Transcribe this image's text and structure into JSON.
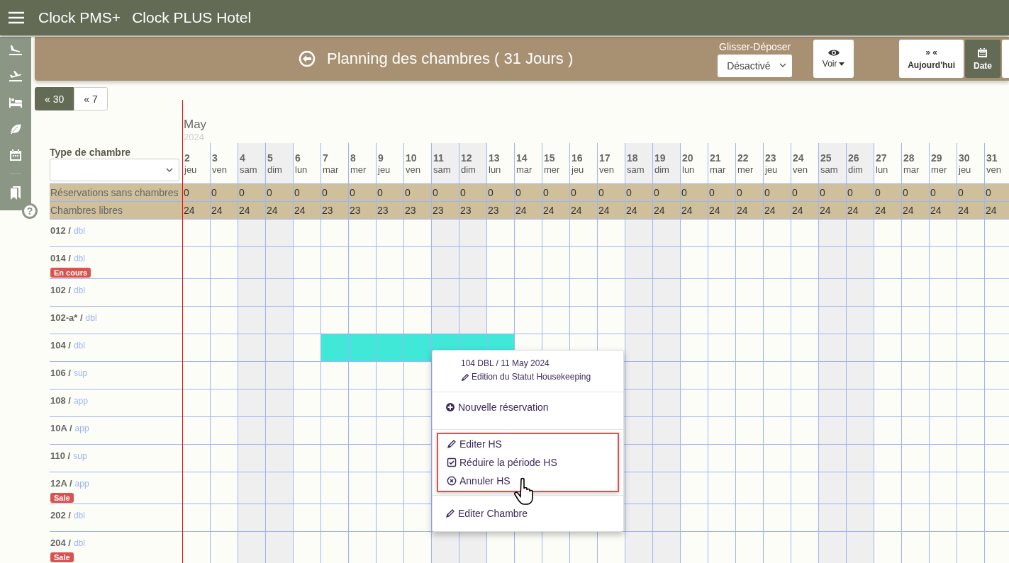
{
  "topbar": {
    "app": "Clock PMS+",
    "hotel": "Clock PLUS Hotel"
  },
  "sidebar": {
    "items": [
      {
        "kind": "arrival"
      },
      {
        "kind": "departure"
      },
      {
        "kind": "bed"
      },
      {
        "kind": "leaf"
      },
      {
        "kind": "calendar"
      },
      {
        "kind": "bookmark"
      }
    ],
    "help": "?"
  },
  "header": {
    "title": "Planning des chambres ( 31 Jours )",
    "drag_label": "Glisser-Déposer",
    "drag_value": "Désactivé",
    "view_button": "Voir",
    "view_buttons": [
      {
        "top": "» «",
        "label": "Aujourd'hui",
        "selected": false
      },
      {
        "kind": "calendar",
        "label": "Date",
        "selected": true
      },
      {
        "selected": false
      }
    ]
  },
  "range_buttons": [
    {
      "label": "« 30",
      "selected": true
    },
    {
      "label": "« 7",
      "selected": false
    }
  ],
  "planning": {
    "month": "May",
    "year": "2024",
    "type_label": "Type de chambre",
    "unassigned_label": "Réservations sans chambres",
    "free_label": "Chambres libres",
    "days": [
      {
        "day": "2",
        "weekday": "jeu",
        "weekend": false,
        "unassigned": "0",
        "free": "24"
      },
      {
        "day": "3",
        "weekday": "ven",
        "weekend": false,
        "unassigned": "0",
        "free": "24"
      },
      {
        "day": "4",
        "weekday": "sam",
        "weekend": true,
        "unassigned": "0",
        "free": "24"
      },
      {
        "day": "5",
        "weekday": "dim",
        "weekend": true,
        "unassigned": "0",
        "free": "24"
      },
      {
        "day": "6",
        "weekday": "lun",
        "weekend": false,
        "unassigned": "0",
        "free": "24"
      },
      {
        "day": "7",
        "weekday": "mar",
        "weekend": false,
        "unassigned": "0",
        "free": "23"
      },
      {
        "day": "8",
        "weekday": "mer",
        "weekend": false,
        "unassigned": "0",
        "free": "23"
      },
      {
        "day": "9",
        "weekday": "jeu",
        "weekend": false,
        "unassigned": "0",
        "free": "23"
      },
      {
        "day": "10",
        "weekday": "ven",
        "weekend": false,
        "unassigned": "0",
        "free": "23"
      },
      {
        "day": "11",
        "weekday": "sam",
        "weekend": true,
        "unassigned": "0",
        "free": "23"
      },
      {
        "day": "12",
        "weekday": "dim",
        "weekend": true,
        "unassigned": "0",
        "free": "23"
      },
      {
        "day": "13",
        "weekday": "lun",
        "weekend": false,
        "unassigned": "0",
        "free": "23"
      },
      {
        "day": "14",
        "weekday": "mar",
        "weekend": false,
        "unassigned": "0",
        "free": "24"
      },
      {
        "day": "15",
        "weekday": "mer",
        "weekend": false,
        "unassigned": "0",
        "free": "24"
      },
      {
        "day": "16",
        "weekday": "jeu",
        "weekend": false,
        "unassigned": "0",
        "free": "24"
      },
      {
        "day": "17",
        "weekday": "ven",
        "weekend": false,
        "unassigned": "0",
        "free": "24"
      },
      {
        "day": "18",
        "weekday": "sam",
        "weekend": true,
        "unassigned": "0",
        "free": "24"
      },
      {
        "day": "19",
        "weekday": "dim",
        "weekend": true,
        "unassigned": "0",
        "free": "24"
      },
      {
        "day": "20",
        "weekday": "lun",
        "weekend": false,
        "unassigned": "0",
        "free": "24"
      },
      {
        "day": "21",
        "weekday": "mar",
        "weekend": false,
        "unassigned": "0",
        "free": "24"
      },
      {
        "day": "22",
        "weekday": "mer",
        "weekend": false,
        "unassigned": "0",
        "free": "24"
      },
      {
        "day": "23",
        "weekday": "jeu",
        "weekend": false,
        "unassigned": "0",
        "free": "24"
      },
      {
        "day": "24",
        "weekday": "ven",
        "weekend": false,
        "unassigned": "0",
        "free": "24"
      },
      {
        "day": "25",
        "weekday": "sam",
        "weekend": true,
        "unassigned": "0",
        "free": "24"
      },
      {
        "day": "26",
        "weekday": "dim",
        "weekend": true,
        "unassigned": "0",
        "free": "24"
      },
      {
        "day": "27",
        "weekday": "lun",
        "weekend": false,
        "unassigned": "0",
        "free": "24"
      },
      {
        "day": "28",
        "weekday": "mar",
        "weekend": false,
        "unassigned": "0",
        "free": "24"
      },
      {
        "day": "29",
        "weekday": "mer",
        "weekend": false,
        "unassigned": "0",
        "free": "24"
      },
      {
        "day": "30",
        "weekday": "jeu",
        "weekend": false,
        "unassigned": "0",
        "free": "24"
      },
      {
        "day": "31",
        "weekday": "ven",
        "weekend": false,
        "unassigned": "0",
        "free": "24"
      }
    ],
    "rooms": [
      {
        "number": "012 /",
        "type": "dbl"
      },
      {
        "number": "014 /",
        "type": "dbl",
        "badge": "En cours"
      },
      {
        "number": "102 /",
        "type": "dbl"
      },
      {
        "number": "102-a* /",
        "type": "dbl"
      },
      {
        "number": "104 /",
        "type": "dbl",
        "hs": [
          false,
          false,
          false,
          false,
          false,
          true,
          true,
          true,
          true,
          true,
          true,
          true,
          false,
          false,
          false,
          false,
          false,
          false,
          false,
          false,
          false,
          false,
          false,
          false,
          false,
          false,
          false,
          false,
          false,
          false
        ]
      },
      {
        "number": "106 /",
        "type": "sup"
      },
      {
        "number": "108 /",
        "type": "app"
      },
      {
        "number": "10A /",
        "type": "app"
      },
      {
        "number": "110 /",
        "type": "sup"
      },
      {
        "number": "12A /",
        "type": "app",
        "badge": "Sale"
      },
      {
        "number": "202 /",
        "type": "dbl"
      },
      {
        "number": "204 /",
        "type": "dbl",
        "badge": "Sale"
      }
    ]
  },
  "context_menu": {
    "heading": "104 DBL / 11 May 2024",
    "link": "Edition du Statut Housekeeping",
    "groups": [
      {
        "highlighted": false,
        "items": [
          {
            "kind": "plus",
            "label": "Nouvelle réservation"
          }
        ]
      },
      {
        "highlighted": true,
        "items": [
          {
            "kind": "pencil",
            "label": "Editer HS"
          },
          {
            "kind": "check",
            "label": "Réduire la période HS"
          },
          {
            "kind": "cancel",
            "label": "Annuler HS"
          }
        ]
      },
      {
        "highlighted": false,
        "items": [
          {
            "kind": "pencil",
            "label": "Editer Chambre"
          }
        ]
      }
    ]
  }
}
